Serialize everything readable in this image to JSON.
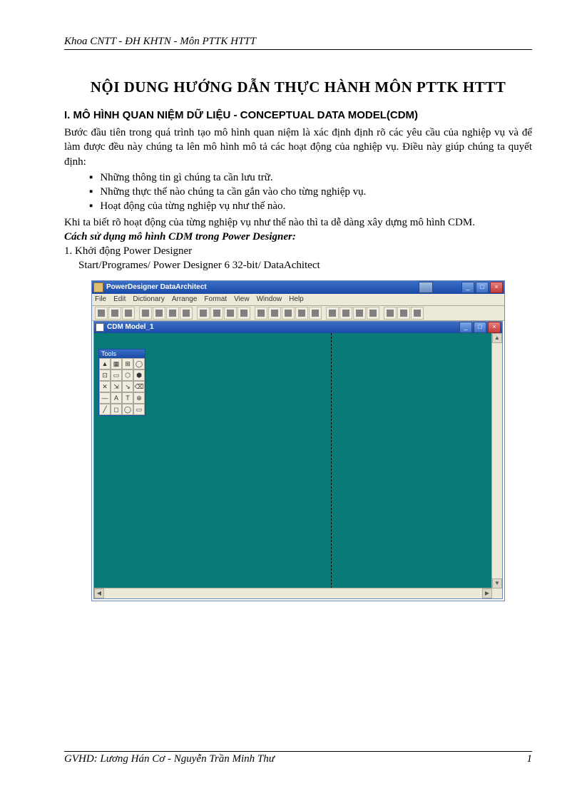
{
  "header": "Khoa CNTT - ĐH KHTN - Môn  PTTK HTTT",
  "title": "NỘI DUNG HƯỚNG DẪN THỰC HÀNH MÔN PTTK HTTT",
  "section_heading": "I. MÔ HÌNH QUAN NIỆM DỮ LIỆU - CONCEPTUAL DATA MODEL(CDM)",
  "para1": "Bước đầu tiên trong quá trình tạo mô hình quan niệm là xác định định rõ các yêu cầu của nghiệp vụ và để làm được đều này chúng ta lên mô hình mô tả các hoạt động của nghiệp vụ. Điều này giúp chúng ta quyết định:",
  "bullets": [
    "Những thông tin gì chúng ta cần lưu trữ.",
    "Những thực thể nào chúng ta cần gắn vào cho từng nghiệp vụ.",
    "Hoạt động của từng nghiệp vụ như thế nào."
  ],
  "para2": "Khi ta biết rõ hoạt động của từng nghiệp vụ như thế nào thì ta dễ dàng xây dựng mô hình CDM.",
  "subheading": "Cách sử dụng mô hình CDM trong Power Designer:",
  "step1": "1.  Khởi động Power Designer",
  "step1_sub": "Start/Programes/  Power Designer  6 32-bit/ DataAchitect",
  "app": {
    "title": "PowerDesigner DataArchitect",
    "menus": [
      "File",
      "Edit",
      "Dictionary",
      "Arrange",
      "Format",
      "View",
      "Window",
      "Help"
    ],
    "inner_title": "CDM Model_1",
    "tools_title": "Tools",
    "tool_glyphs": [
      "▲",
      "▦",
      "⊞",
      "◯",
      "⊡",
      "▭",
      "⬡",
      "⬢",
      "✕",
      "⇲",
      "↘",
      "⌫",
      "—",
      "A",
      "T",
      "⊕",
      "╱",
      "◻",
      "◯",
      "▭"
    ],
    "win_min": "_",
    "win_max": "□",
    "win_close": "×"
  },
  "footer_left": "GVHD:  Lương Hán Cơ  - Nguyễn Trần Minh Thư",
  "footer_right": "1"
}
